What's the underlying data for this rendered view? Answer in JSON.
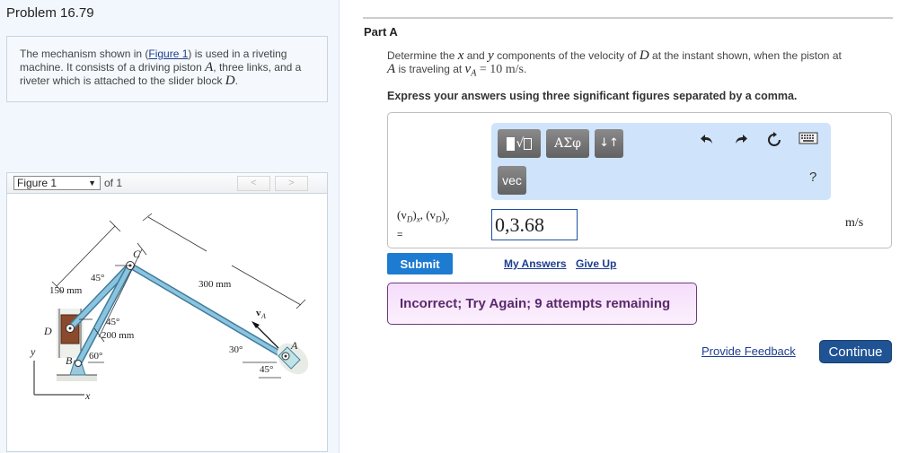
{
  "problem": {
    "title": "Problem 16.79",
    "intro_before_link": "The mechanism shown in (",
    "figure_link": "Figure 1",
    "intro_after_link": ") is used in a riveting machine. It consists of a driving piston ",
    "var_A": "A",
    "intro_middle": ", three links, and a riveter which is attached to the slider block ",
    "var_D": "D",
    "intro_end": "."
  },
  "figure_nav": {
    "selected": "Figure 1",
    "of_label": "of 1",
    "prev_icon": "chevron-left",
    "next_icon": "chevron-right"
  },
  "figure": {
    "labels": {
      "C": "C",
      "D": "D",
      "B": "B",
      "A": "A",
      "x": "x",
      "y": "y",
      "vA": "v",
      "vA_sub": "A",
      "len_150": "150 mm",
      "len_200": "200 mm",
      "len_300": "300 mm",
      "ang_45_top": "45°",
      "ang_45_mid": "45°",
      "ang_60": "60°",
      "ang_30": "30°",
      "ang_45_piston": "45°"
    },
    "colors": {
      "link": "#7fb8d6",
      "link_edge": "#3f7d9c",
      "block": "#8b4a2b",
      "support": "#9cc8dc"
    }
  },
  "part": {
    "title": "Part A",
    "question_pre": "Determine the ",
    "x": "x",
    "and": " and ",
    "y": "y",
    "question_mid": " components of the velocity of ",
    "D": "D",
    "question_post": " at the instant shown, when the piston at ",
    "A": "A",
    "question_tail": " is traveling at ",
    "vA": "v",
    "vA_sub": "A",
    "vA_value": " = 10  m/s",
    "question_end": ".",
    "instruction": "Express your answers using three significant figures separated by a comma."
  },
  "toolbar": {
    "templates_label": "√",
    "greek_label": "ΑΣφ",
    "arrows_label": "↓↑",
    "vec_label": "vec",
    "undo_icon": "undo-arrow",
    "redo_icon": "redo-arrow",
    "reset_icon": "refresh",
    "keyboard_icon": "keyboard",
    "help_label": "?"
  },
  "answer": {
    "label_x": "(v",
    "label_sub_D": "D",
    "label_sub_x": "x",
    "label_sep": ", (v",
    "label_sub_y": "y",
    "equals": "=",
    "value": "0,3.68",
    "units": "m/s"
  },
  "actions": {
    "submit": "Submit",
    "my_answers": "My Answers",
    "give_up": "Give Up",
    "feedback_message": "Incorrect; Try Again; 9 attempts remaining",
    "provide_feedback": "Provide Feedback",
    "continue": "Continue"
  }
}
